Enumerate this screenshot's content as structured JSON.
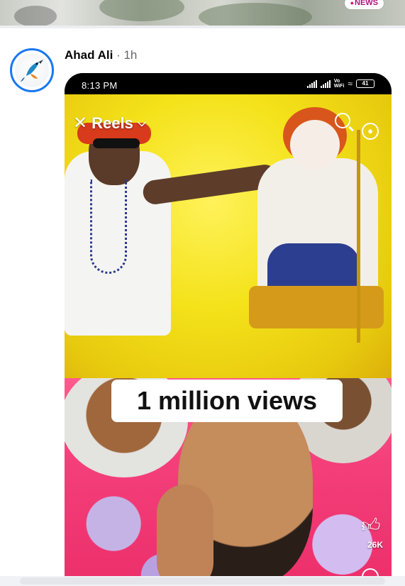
{
  "top_post": {
    "badge_text": "NEWS",
    "badge_icon": "pin-icon"
  },
  "post": {
    "author": "Ahad Ali",
    "separator": "·",
    "time": "1h",
    "avatar_icon": "kingfisher-bird-icon"
  },
  "screenshot": {
    "status_time": "8:13 PM",
    "status_volte_top": "Vo",
    "status_volte_bottom": "WiFi",
    "battery": "41",
    "reels_label": "Reels",
    "banner_text": "1 million views",
    "like_count": "26K"
  },
  "colors": {
    "link_blue": "#1877f2",
    "reel_yellow": "#f4e21a",
    "fabric_pink": "#ec2f6b",
    "news_magenta": "#b5127a"
  }
}
